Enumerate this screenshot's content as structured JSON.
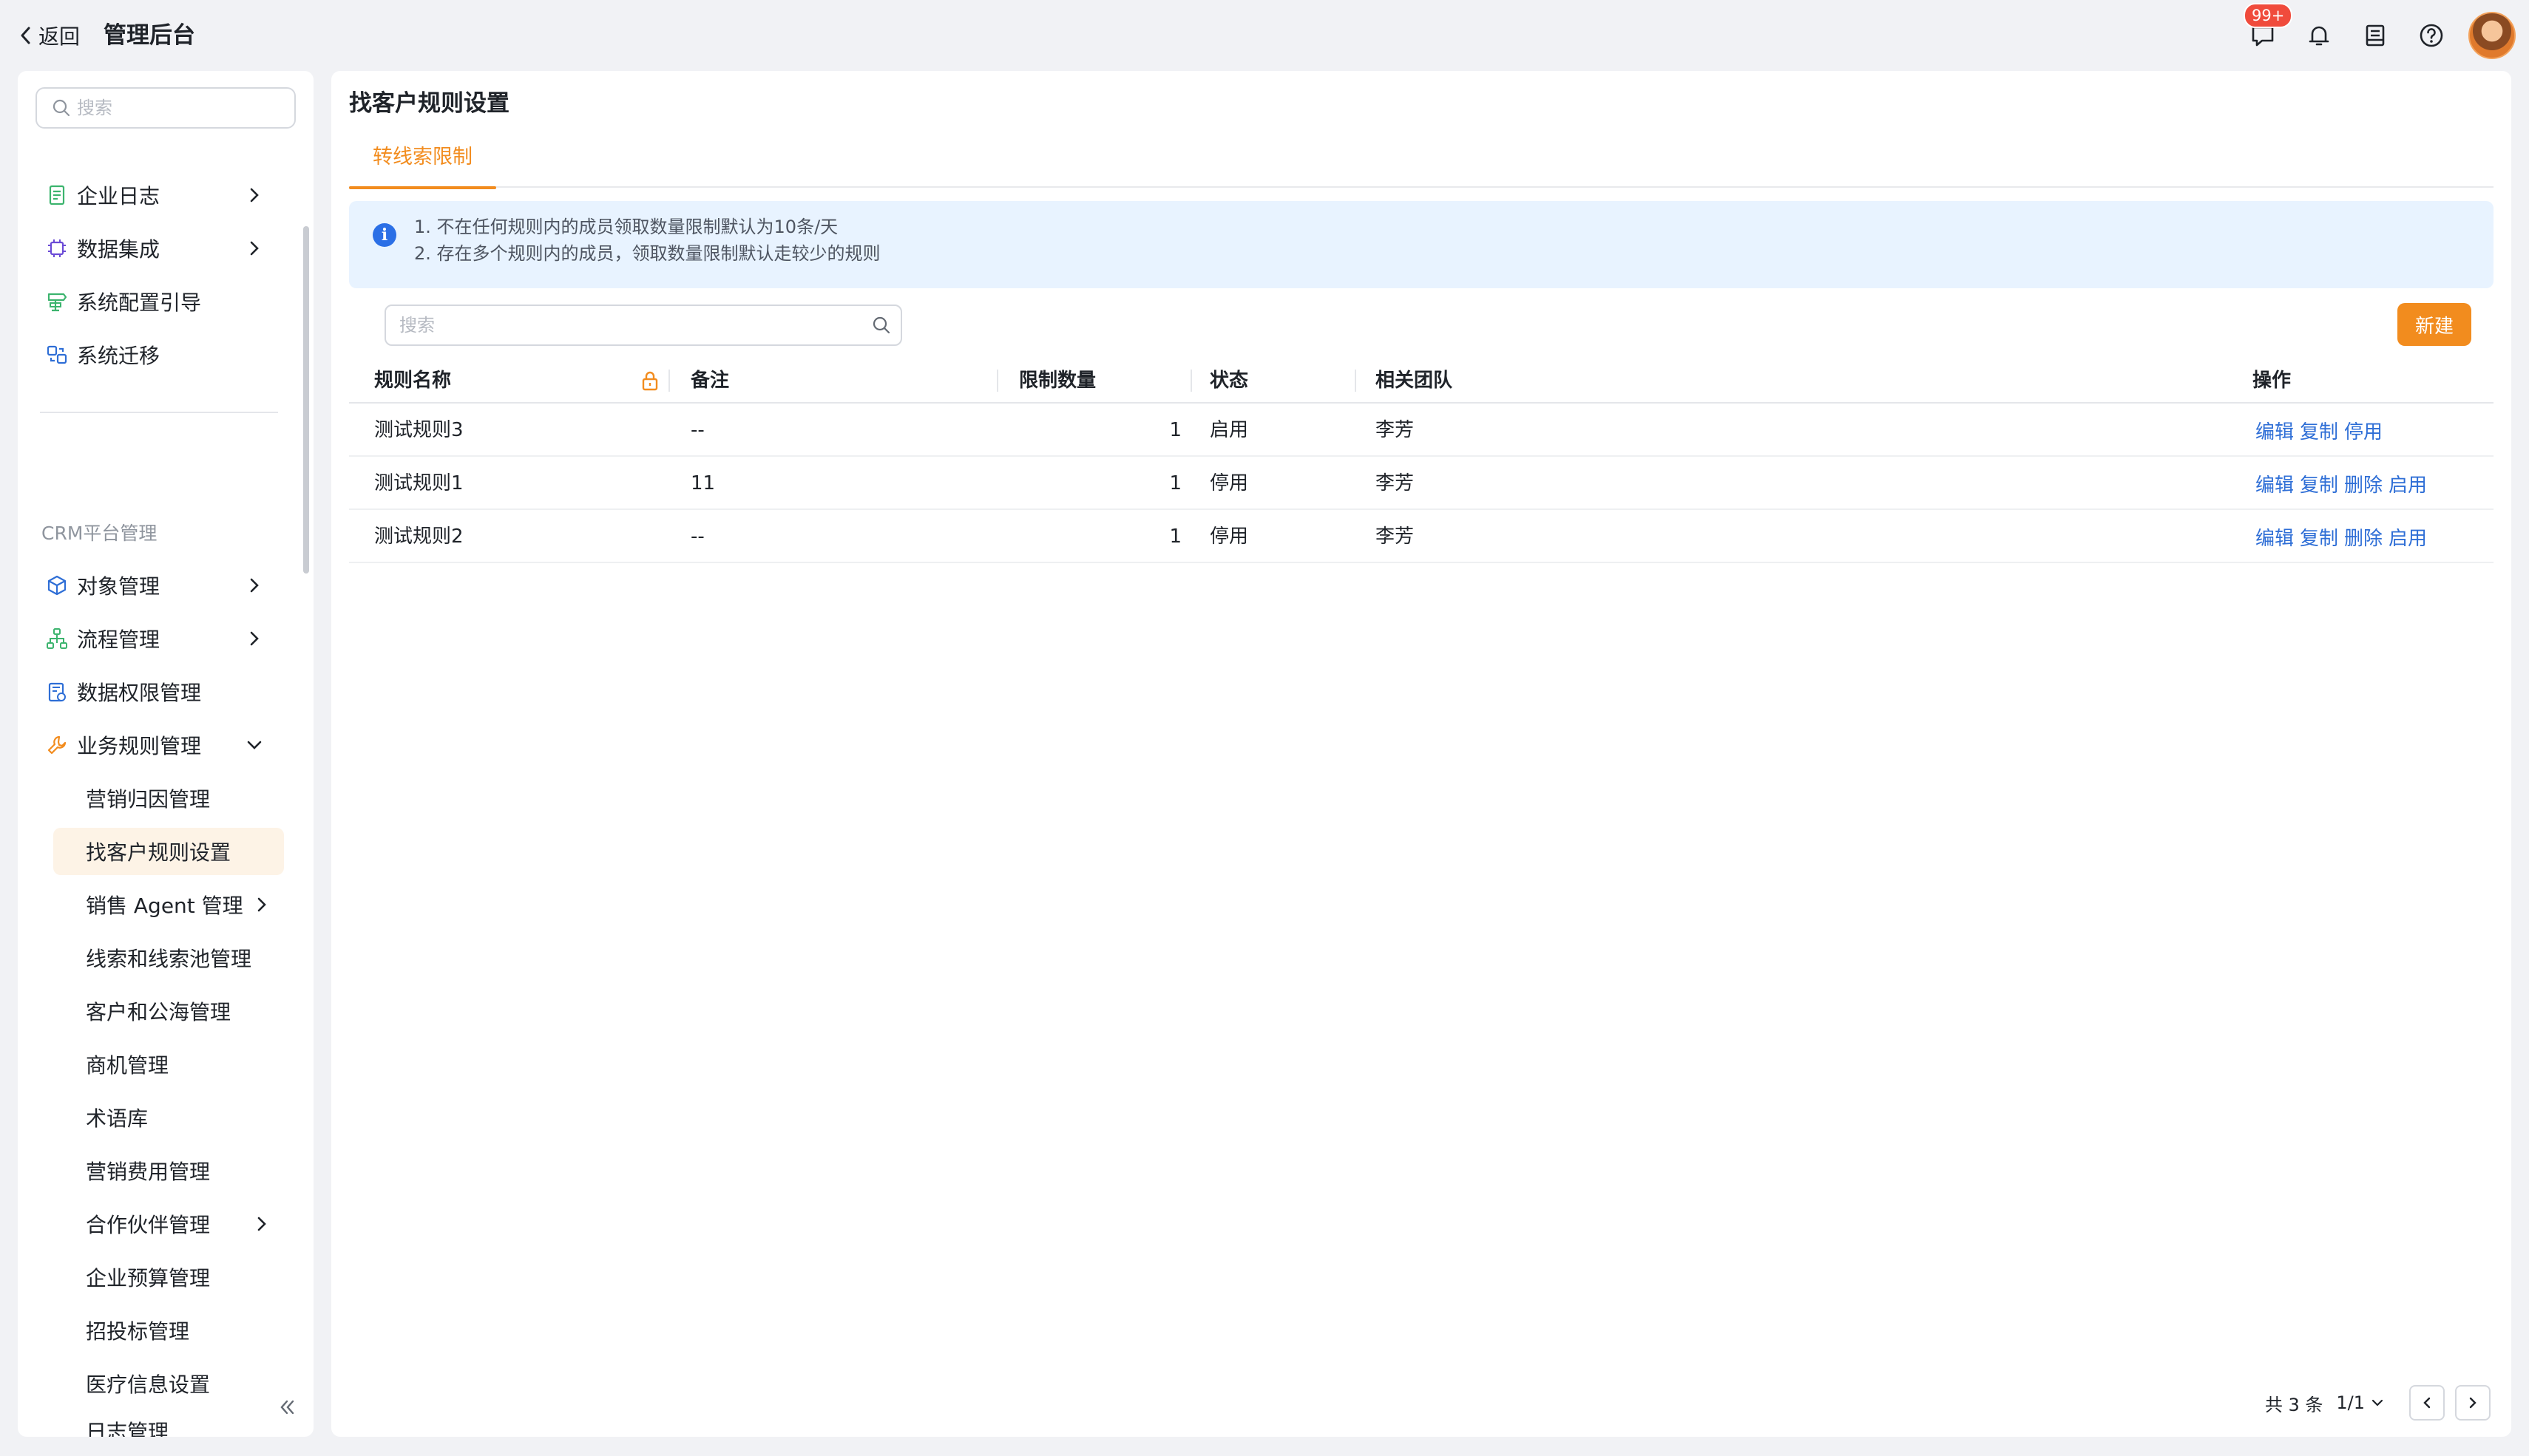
{
  "topbar": {
    "back_label": "返回",
    "title": "管理后台",
    "badge": "99+"
  },
  "sidebar": {
    "search_placeholder": "搜索",
    "items": [
      {
        "label": "企业日志",
        "icon": "file-list-icon",
        "chevron": true
      },
      {
        "label": "数据集成",
        "icon": "chip-icon",
        "chevron": true
      },
      {
        "label": "系统配置引导",
        "icon": "signpost-icon",
        "chevron": false
      },
      {
        "label": "系统迁移",
        "icon": "migrate-icon",
        "chevron": false
      }
    ],
    "section": "CRM平台管理",
    "crm_items": [
      {
        "label": "对象管理",
        "icon": "cube-icon",
        "chevron": true
      },
      {
        "label": "流程管理",
        "icon": "flow-tree-icon",
        "chevron": true
      },
      {
        "label": "数据权限管理",
        "icon": "data-permission-icon",
        "chevron": false
      },
      {
        "label": "业务规则管理",
        "icon": "wrench-icon",
        "chevron": "down"
      }
    ],
    "sub_items": [
      {
        "label": "营销归因管理"
      },
      {
        "label": "找客户规则设置",
        "active": true
      },
      {
        "label": "销售 Agent 管理",
        "chevron": true
      },
      {
        "label": "线索和线索池管理"
      },
      {
        "label": "客户和公海管理"
      },
      {
        "label": "商机管理"
      },
      {
        "label": "术语库"
      },
      {
        "label": "营销费用管理"
      },
      {
        "label": "合作伙伴管理",
        "chevron": true
      },
      {
        "label": "企业预算管理"
      },
      {
        "label": "招投标管理"
      },
      {
        "label": "医疗信息设置"
      },
      {
        "label": "日志管理"
      }
    ]
  },
  "main": {
    "title": "找客户规则设置",
    "tab": "转线索限制",
    "notice": [
      "1. 不在任何规则内的成员领取数量限制默认为10条/天",
      "2. 存在多个规则内的成员，领取数量限制默认走较少的规则"
    ],
    "search_placeholder": "搜索",
    "new_button": "新建",
    "table": {
      "headers": [
        "规则名称",
        "备注",
        "限制数量",
        "状态",
        "相关团队",
        "操作"
      ],
      "rows": [
        {
          "name": "测试规则3",
          "remark": "--",
          "limit": "1",
          "status": "启用",
          "team": "李芳",
          "actions": [
            "编辑",
            "复制",
            "停用"
          ]
        },
        {
          "name": "测试规则1",
          "remark": "11",
          "limit": "1",
          "status": "停用",
          "team": "李芳",
          "actions": [
            "编辑",
            "复制",
            "删除",
            "启用"
          ]
        },
        {
          "name": "测试规则2",
          "remark": "--",
          "limit": "1",
          "status": "停用",
          "team": "李芳",
          "actions": [
            "编辑",
            "复制",
            "删除",
            "启用"
          ]
        }
      ]
    },
    "pager": {
      "total": "共 3 条",
      "page": "1/1"
    }
  },
  "colors": {
    "accent": "#f28c1e",
    "link": "#2e6ed6",
    "notice_bg": "#e8f3ff",
    "badge": "#f04b3c"
  }
}
